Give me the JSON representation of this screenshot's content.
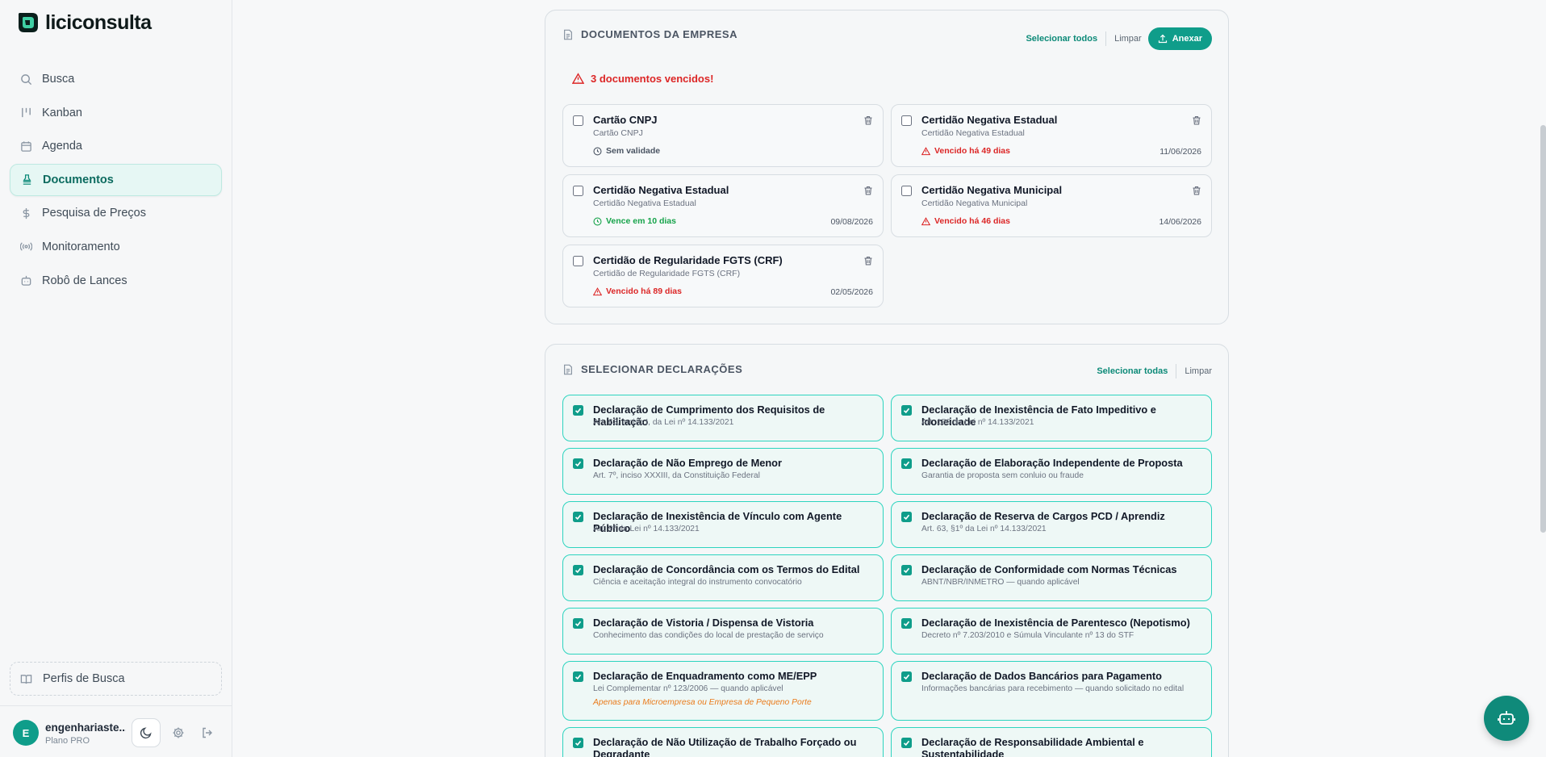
{
  "app": {
    "name": "liciconsulta"
  },
  "sidebar": {
    "items": [
      {
        "label": "Busca",
        "icon": "search-icon"
      },
      {
        "label": "Kanban",
        "icon": "kanban-icon"
      },
      {
        "label": "Agenda",
        "icon": "calendar-icon"
      },
      {
        "label": "Documentos",
        "icon": "stamp-icon",
        "active": true
      },
      {
        "label": "Pesquisa de Preços",
        "icon": "dollar-icon"
      },
      {
        "label": "Monitoramento",
        "icon": "radio-icon"
      },
      {
        "label": "Robô de Lances",
        "icon": "bot-icon"
      }
    ],
    "profiles_label": "Perfis de Busca",
    "user": {
      "initial": "E",
      "name": "engenhariaste...",
      "plan": "Plano PRO"
    }
  },
  "documents": {
    "title": "DOCUMENTOS DA EMPRESA",
    "select_all": "Selecionar todos",
    "clear": "Limpar",
    "attach": "Anexar",
    "alert": "3 documentos vencidos!",
    "items": [
      {
        "title": "Cartão CNPJ",
        "subtitle": "Cartão CNPJ",
        "status": "Sem validade",
        "status_type": "none",
        "date": ""
      },
      {
        "title": "Certidão Negativa Estadual",
        "subtitle": "Certidão Negativa Estadual",
        "status": "Vencido há 49 dias",
        "status_type": "expired",
        "date": "11/06/2026"
      },
      {
        "title": "Certidão Negativa Estadual",
        "subtitle": "Certidão Negativa Estadual",
        "status": "Vence em 10 dias",
        "status_type": "soon",
        "date": "09/08/2026"
      },
      {
        "title": "Certidão Negativa Municipal",
        "subtitle": "Certidão Negativa Municipal",
        "status": "Vencido há 46 dias",
        "status_type": "expired",
        "date": "14/06/2026"
      },
      {
        "title": "Certidão de Regularidade FGTS (CRF)",
        "subtitle": "Certidão de Regularidade FGTS (CRF)",
        "status": "Vencido há 89 dias",
        "status_type": "expired",
        "date": "02/05/2026"
      }
    ]
  },
  "declarations": {
    "title": "SELECIONAR DECLARAÇÕES",
    "select_all": "Selecionar todas",
    "clear": "Limpar",
    "items": [
      {
        "title": "Declaração de Cumprimento dos Requisitos de Habilitação",
        "subtitle": "Art. 63, inciso I, da Lei nº 14.133/2021",
        "checked": true
      },
      {
        "title": "Declaração de Inexistência de Fato Impeditivo e Idoneidade",
        "subtitle": "Art. 156 da Lei nº 14.133/2021",
        "checked": true
      },
      {
        "title": "Declaração de Não Emprego de Menor",
        "subtitle": "Art. 7º, inciso XXXIII, da Constituição Federal",
        "checked": true
      },
      {
        "title": "Declaração de Elaboração Independente de Proposta",
        "subtitle": "Garantia de proposta sem conluio ou fraude",
        "checked": true
      },
      {
        "title": "Declaração de Inexistência de Vínculo com Agente Público",
        "subtitle": "Art. 9º da Lei nº 14.133/2021",
        "checked": true
      },
      {
        "title": "Declaração de Reserva de Cargos PCD / Aprendiz",
        "subtitle": "Art. 63, §1º da Lei nº 14.133/2021",
        "checked": true
      },
      {
        "title": "Declaração de Concordância com os Termos do Edital",
        "subtitle": "Ciência e aceitação integral do instrumento convocatório",
        "checked": true
      },
      {
        "title": "Declaração de Conformidade com Normas Técnicas",
        "subtitle": "ABNT/NBR/INMETRO — quando aplicável",
        "checked": true
      },
      {
        "title": "Declaração de Vistoria / Dispensa de Vistoria",
        "subtitle": "Conhecimento das condições do local de prestação de serviço",
        "checked": true
      },
      {
        "title": "Declaração de Inexistência de Parentesco (Nepotismo)",
        "subtitle": "Decreto nº 7.203/2010 e Súmula Vinculante nº 13 do STF",
        "checked": true
      },
      {
        "title": "Declaração de Enquadramento como ME/EPP",
        "subtitle": "Lei Complementar nº 123/2006 — quando aplicável",
        "note": "Apenas para Microempresa ou Empresa de Pequeno Porte",
        "checked": true
      },
      {
        "title": "Declaração de Dados Bancários para Pagamento",
        "subtitle": "Informações bancárias para recebimento — quando solicitado no edital",
        "checked": true
      },
      {
        "title": "Declaração de Não Utilização de Trabalho Forçado ou Degradante",
        "subtitle": "",
        "checked": true
      },
      {
        "title": "Declaração de Responsabilidade Ambiental e Sustentabilidade",
        "subtitle": "",
        "checked": true
      }
    ]
  },
  "colors": {
    "accent": "#0f9d8a",
    "danger": "#dc2626",
    "success": "#16a34a",
    "warning": "#ea7a1a"
  }
}
